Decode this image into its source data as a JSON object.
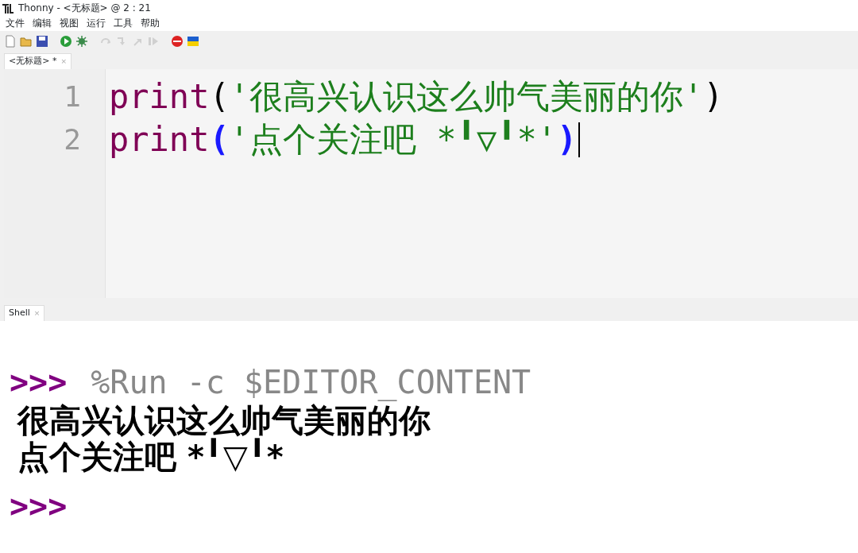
{
  "window": {
    "title": "Thonny  -  <无标题>  @  2 : 21"
  },
  "menu": [
    "文件",
    "编辑",
    "视图",
    "运行",
    "工具",
    "帮助"
  ],
  "toolbar": [
    {
      "kind": "new",
      "disabled": false
    },
    {
      "kind": "open",
      "disabled": false
    },
    {
      "kind": "save",
      "disabled": false
    },
    {
      "kind": "run",
      "disabled": false
    },
    {
      "kind": "debug",
      "disabled": false
    },
    {
      "kind": "step-over",
      "disabled": true
    },
    {
      "kind": "step-into",
      "disabled": true
    },
    {
      "kind": "step-out",
      "disabled": true
    },
    {
      "kind": "resume",
      "disabled": true
    },
    {
      "kind": "stop",
      "disabled": false
    },
    {
      "kind": "flag",
      "disabled": false
    }
  ],
  "editor_tabs": [
    {
      "label": "<无标题> *",
      "selected": true,
      "close": "×"
    }
  ],
  "editor": {
    "lines": [
      {
        "number": "1",
        "tokens": [
          {
            "kind": "builtin",
            "text": "print"
          },
          {
            "kind": "paren",
            "text": "("
          },
          {
            "kind": "string",
            "text": "'很高兴认识这么帅气美丽的你'"
          },
          {
            "kind": "paren",
            "text": ")"
          }
        ]
      },
      {
        "number": "2",
        "tokens": [
          {
            "kind": "builtin",
            "text": "print"
          },
          {
            "kind": "paren-match",
            "text": "("
          },
          {
            "kind": "string",
            "text": "'点个关注吧 *╹▽╹*'"
          },
          {
            "kind": "paren-match",
            "text": ")"
          }
        ]
      }
    ]
  },
  "shell_tab": {
    "label": "Shell",
    "close": "×"
  },
  "shell": {
    "lines": [
      {
        "kind": "command",
        "prompt": ">>>",
        "text": "%Run -c $EDITOR_CONTENT"
      },
      {
        "kind": "output",
        "text": "很高兴认识这么帅气美丽的你"
      },
      {
        "kind": "output",
        "text": "点个关注吧 *╹▽╹*"
      },
      {
        "kind": "blank"
      },
      {
        "kind": "prompt",
        "prompt": ">>>"
      }
    ]
  }
}
